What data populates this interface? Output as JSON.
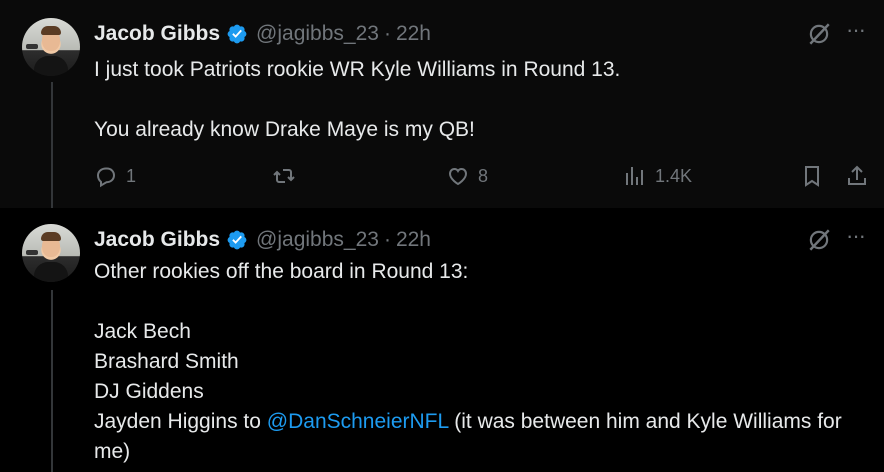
{
  "tweets": [
    {
      "author": {
        "name": "Jacob Gibbs",
        "handle": "@jagibbs_23"
      },
      "dot": "·",
      "time": "22h",
      "lines": [
        "I just took Patriots rookie WR Kyle Williams in Round 13.",
        "You already know Drake Maye is my QB!"
      ],
      "stats": {
        "replies": "1",
        "likes": "8",
        "views": "1.4K"
      }
    },
    {
      "author": {
        "name": "Jacob Gibbs",
        "handle": "@jagibbs_23"
      },
      "dot": "·",
      "time": "22h",
      "lines": [
        "Other rookies off the board in Round 13:",
        "Jack Bech",
        "Brashard Smith",
        "DJ Giddens"
      ],
      "last_line": {
        "before": "Jayden Higgins to ",
        "mention": "@DanSchneierNFL",
        "after": " (it was between him and Kyle Williams for me)"
      }
    }
  ],
  "icons": {
    "verified": "verified-badge-icon",
    "grok": "grok-icon",
    "more": "more-icon",
    "reply": "reply-icon",
    "retweet": "retweet-icon",
    "like": "like-icon",
    "views": "views-icon",
    "bookmark": "bookmark-icon",
    "share": "share-icon"
  },
  "colors": {
    "accent": "#1d9bf0",
    "text": "#e7e9ea",
    "muted": "#71767b",
    "background": "#000000"
  }
}
